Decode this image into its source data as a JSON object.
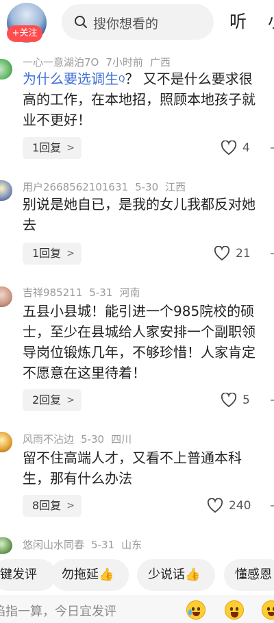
{
  "header": {
    "follow_label": "+关注",
    "search_placeholder": "搜你想看的",
    "tab_listen": "听",
    "tab_cut": "小"
  },
  "comments": [
    {
      "user": "一心一意湖泊7O",
      "time": "7小时前",
      "location": "广西",
      "text_link": "为什么要选调生",
      "text_link_sup": "Q",
      "text_line1_rest": "？ 又不是什么要求很",
      "text_line2": "高的工作，在本地招，照顾本地孩子就",
      "text_line3": "业不更好！",
      "replies": "1回复",
      "likes": "4"
    },
    {
      "user": "用户2668562101631",
      "time": "5-30",
      "location": "江西",
      "text_line1": "别说是她自已，是我的女儿我都反对她",
      "text_line2": "去",
      "replies": "1回复",
      "likes": "21"
    },
    {
      "user": "吉祥985211",
      "time": "5-31",
      "location": "河南",
      "text_line1": "五县小县城！能引进一个985院校的硕",
      "text_line2": "士，至少在县城给人家安排一个副职领",
      "text_line3": "导岗位锻炼几年，不够珍惜！人家肯定",
      "text_line4": "不愿意在这里待着！",
      "replies": "2回复",
      "likes": "5"
    },
    {
      "user": "风雨不沾边",
      "time": "5-30",
      "location": "四川",
      "text_line1": "留不住高端人才，又看不上普通本科",
      "text_line2": "生，那有什么办法",
      "replies": "8回复",
      "likes": "240"
    },
    {
      "user": "悠闲山水同春",
      "time": "5-31",
      "location": "山东"
    }
  ],
  "chips": [
    "键发评",
    "勿拖延👍",
    "少说话👍",
    "懂感恩"
  ],
  "input": {
    "placeholder": "掐指一算，今日宜发评"
  },
  "colors": {
    "link": "#3b6dd8",
    "follow_bg": "#ff4d4f",
    "chip_bg": "#f2f2f2"
  }
}
